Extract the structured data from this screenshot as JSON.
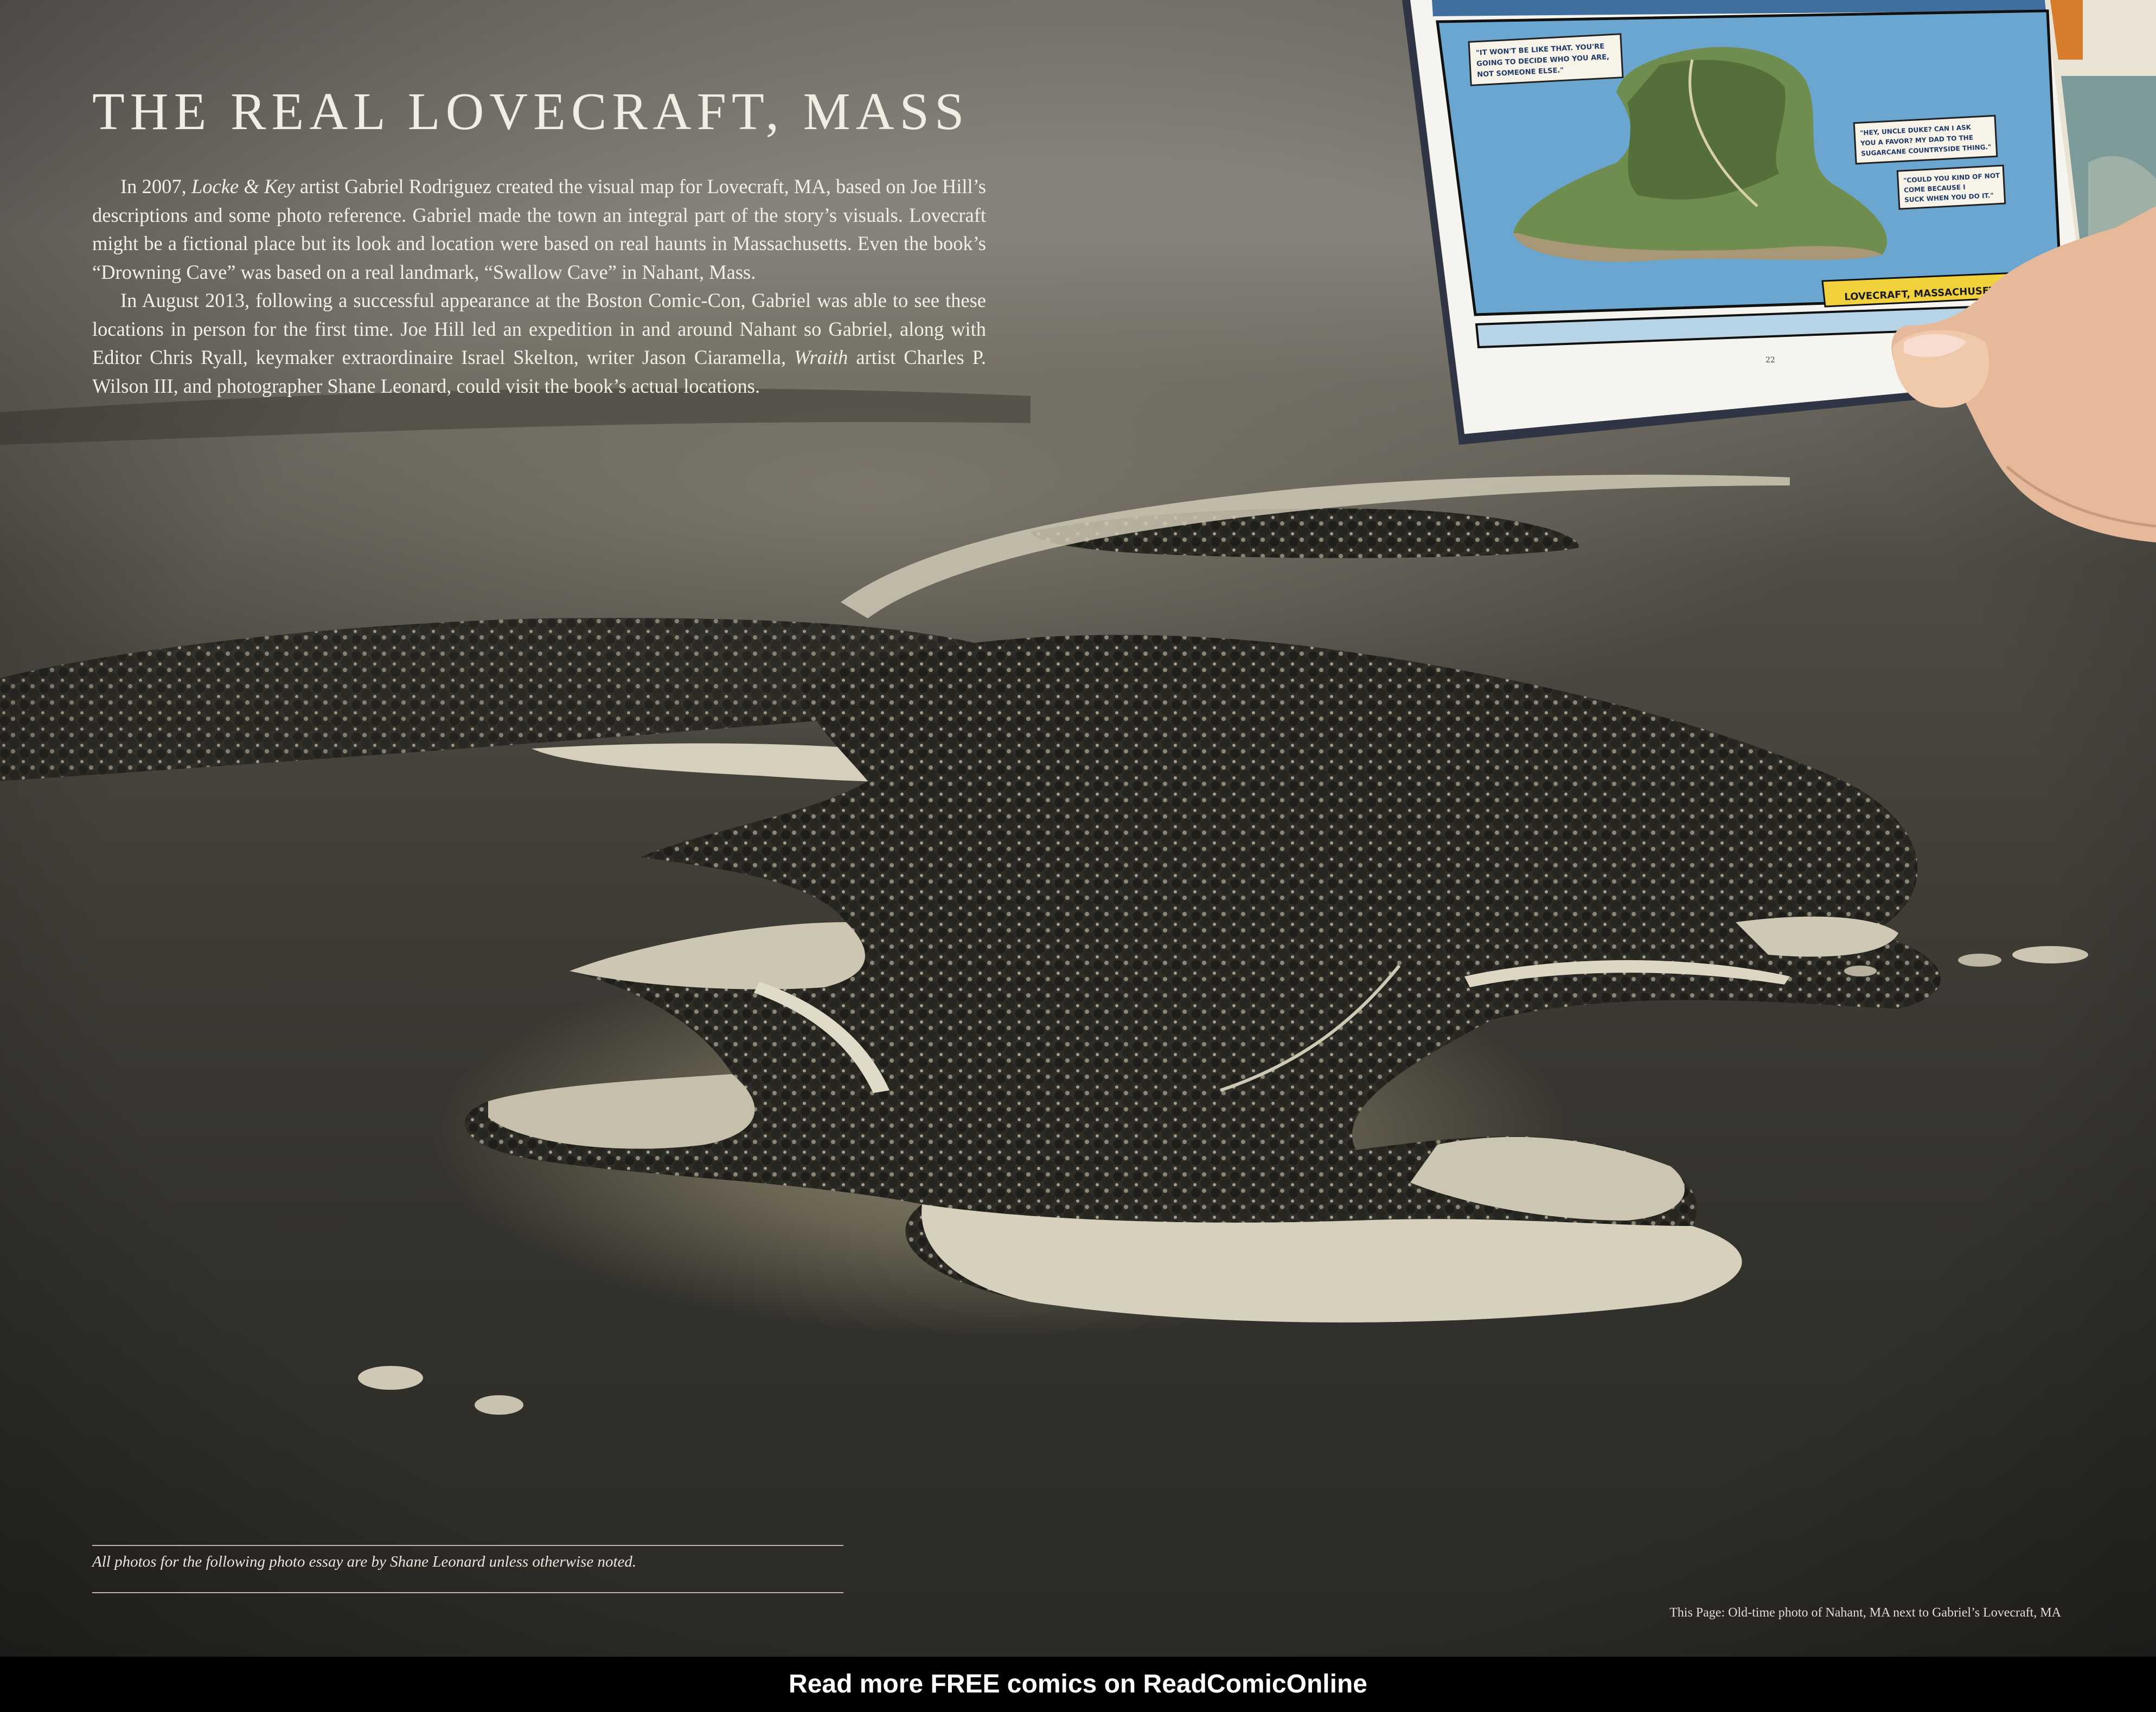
{
  "article": {
    "title": "THE REAL LOVECRAFT, MASS",
    "p1": {
      "a": "In 2007, ",
      "em": "Locke & Key",
      "b": " artist Gabriel Rodriguez created the visual map for Lovecraft, MA, based on Joe Hill’s descriptions and some photo reference. Gabriel made the town an integral part of the story’s visuals. Lovecraft might be a fictional place but its look and location were based on real haunts in Massachusetts. Even the book’s “Drowning Cave” was based on a real landmark, “Swallow Cave” in Nahant, Mass."
    },
    "p2": {
      "a": "In August 2013, following a successful appearance at the Boston Comic-Con, Gabriel was able to see these locations in person for the first time. Joe Hill led an expedition in and around Nahant so Gabriel, along with Editor Chris Ryall, keymaker extraordinaire Israel Skelton, writer Jason Ciaramella, ",
      "em": "Wraith",
      "b": " artist Charles P. Wilson III, and photographer Shane Leonard, could visit the book’s actual locations."
    },
    "credit": "All photos for the following photo essay are by Shane Leonard unless otherwise noted.",
    "caption": "This Page: Old-time photo of Nahant, MA next to Gabriel’s Lovecraft, MA"
  },
  "comic": {
    "location_caption": "LOVECRAFT, MASSACHUSETTS",
    "page_number": "22",
    "balloon1": [
      "\"IT WON'T BE LIKE THAT. YOU'RE",
      "GOING TO DECIDE WHO YOU ARE,",
      "NOT SOMEONE ELSE.\""
    ],
    "balloon2": [
      "\"HEY, UNCLE DUKE? CAN I ASK",
      "YOU A FAVOR? MY DAD TO THE",
      "SUGARCANE COUNTRYSIDE THING.\""
    ],
    "balloon3": [
      "\"COULD YOU KIND OF NOT",
      "COME BECAUSE I",
      "SUCK WHEN YOU DO IT.\""
    ]
  },
  "banner": {
    "text": "Read more FREE comics on ReadComicOnline"
  },
  "colors": {
    "sepia_water": "#3a3731",
    "land": "#d8d2c1",
    "comic_sea": "#6aa6cf",
    "caption_yellow": "#f2d23c",
    "banner_bg": "#000000"
  }
}
